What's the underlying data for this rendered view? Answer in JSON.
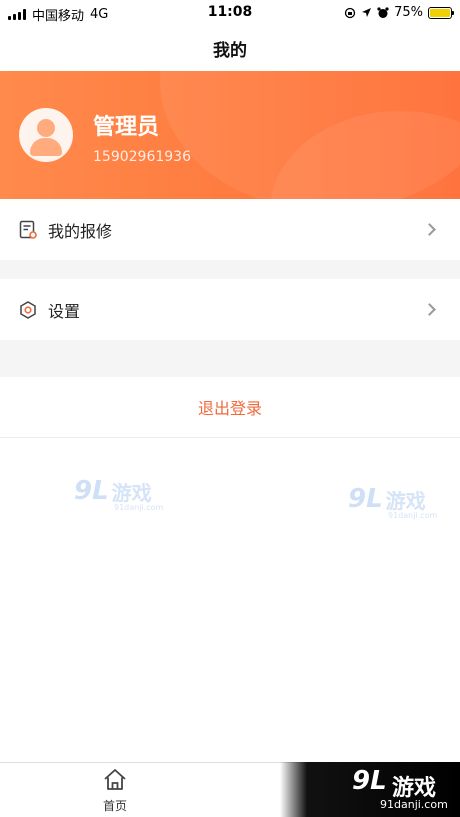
{
  "status_bar": {
    "carrier": "中国移动",
    "network": "4G",
    "time": "11:08",
    "battery": "75%"
  },
  "header": {
    "title": "我的"
  },
  "profile": {
    "name": "管理员",
    "phone": "15902961936"
  },
  "menu": {
    "repair_label": "我的报修",
    "settings_label": "设置"
  },
  "logout_label": "退出登录",
  "watermarks": {
    "brand_num": "9L",
    "brand_cn": "游戏",
    "site": "91danji.com"
  },
  "tabbar": {
    "home_label": "首页"
  },
  "colors": {
    "accent": "#ff7a3e",
    "logout_text": "#f06a3c",
    "battery_fill": "#f0d000"
  }
}
